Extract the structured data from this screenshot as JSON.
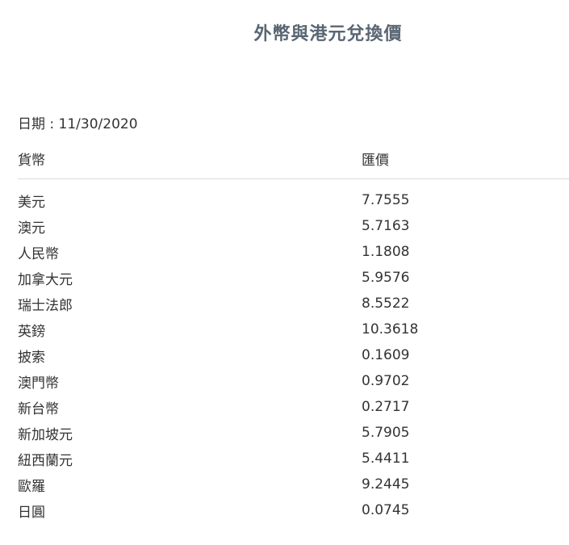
{
  "title": "外幣與港元兌換價",
  "date": {
    "label": "日期 : ",
    "value": "11/30/2020"
  },
  "table": {
    "headers": {
      "currency": "貨幣",
      "rate": "匯價"
    },
    "rows": [
      {
        "currency": "美元",
        "rate": "7.7555"
      },
      {
        "currency": "澳元",
        "rate": "5.7163"
      },
      {
        "currency": "人民幣",
        "rate": "1.1808"
      },
      {
        "currency": "加拿大元",
        "rate": "5.9576"
      },
      {
        "currency": "瑞士法郎",
        "rate": "8.5522"
      },
      {
        "currency": "英鎊",
        "rate": "10.3618"
      },
      {
        "currency": "披索",
        "rate": "0.1609"
      },
      {
        "currency": "澳門幣",
        "rate": "0.9702"
      },
      {
        "currency": "新台幣",
        "rate": "0.2717"
      },
      {
        "currency": "新加坡元",
        "rate": "5.7905"
      },
      {
        "currency": "紐西蘭元",
        "rate": "5.4411"
      },
      {
        "currency": "歐羅",
        "rate": "9.2445"
      },
      {
        "currency": "日圓",
        "rate": "0.0745"
      }
    ]
  },
  "colors": {
    "title": "#5a6673",
    "text": "#333333",
    "divider": "#d9d9d9"
  }
}
